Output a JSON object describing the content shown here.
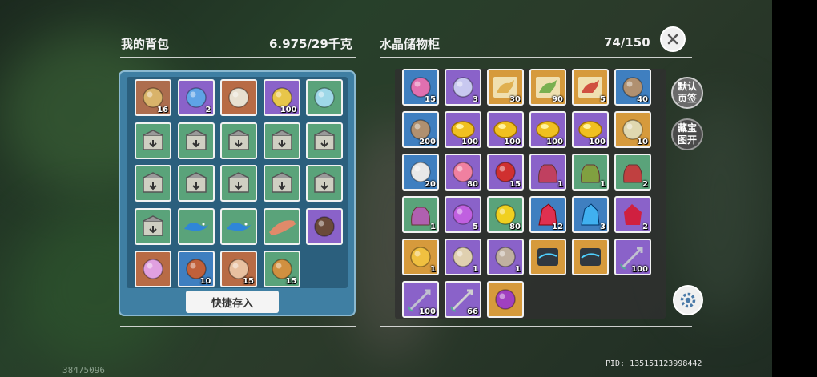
{
  "bag": {
    "title": "我的背包",
    "weight": "6.975/29千克",
    "quick_store_label": "快捷存入",
    "items": [
      {
        "count": "16",
        "bg": "#ad6d4e",
        "icon": "scroll-icon",
        "c": "#d9b36a"
      },
      {
        "count": "2",
        "bg": "#8a62c9",
        "icon": "machine-icon",
        "c": "#5fa3e6"
      },
      {
        "count": "",
        "bg": "#b86b45",
        "icon": "horn-icon",
        "c": "#e8e0d0"
      },
      {
        "count": "100",
        "bg": "#8a62c9",
        "icon": "robot-icon",
        "c": "#e8c64a"
      },
      {
        "count": "",
        "bg": "#5aa37a",
        "icon": "duck-icon",
        "c": "#9ed8e8"
      },
      {
        "count": "",
        "bg": "#5aa37a",
        "icon": "crate-icon",
        "c": "#cfcfc2"
      },
      {
        "count": "",
        "bg": "#5aa37a",
        "icon": "crate-icon",
        "c": "#cfcfc2"
      },
      {
        "count": "",
        "bg": "#5aa37a",
        "icon": "crate-icon",
        "c": "#cfcfc2"
      },
      {
        "count": "",
        "bg": "#5aa37a",
        "icon": "crate-icon",
        "c": "#cfcfc2"
      },
      {
        "count": "",
        "bg": "#5aa37a",
        "icon": "crate-icon",
        "c": "#cfcfc2"
      },
      {
        "count": "",
        "bg": "#5aa37a",
        "icon": "crate-icon",
        "c": "#cfcfc2"
      },
      {
        "count": "",
        "bg": "#5aa37a",
        "icon": "crate-icon",
        "c": "#cfcfc2"
      },
      {
        "count": "",
        "bg": "#5aa37a",
        "icon": "crate-icon",
        "c": "#cfcfc2"
      },
      {
        "count": "",
        "bg": "#5aa37a",
        "icon": "crate-icon",
        "c": "#cfcfc2"
      },
      {
        "count": "",
        "bg": "#5aa37a",
        "icon": "crate-icon",
        "c": "#cfcfc2"
      },
      {
        "count": "",
        "bg": "#5aa37a",
        "icon": "crate-icon",
        "c": "#cfcfc2"
      },
      {
        "count": "",
        "bg": "#5aa37a",
        "icon": "lizard-icon",
        "c": "#2f86d8"
      },
      {
        "count": "",
        "bg": "#5aa37a",
        "icon": "lizard-icon",
        "c": "#2f86d8"
      },
      {
        "count": "",
        "bg": "#5aa37a",
        "icon": "fish-icon",
        "c": "#e08a6a"
      },
      {
        "count": "",
        "bg": "#8a62c9",
        "icon": "bow-icon",
        "c": "#6a4a3a"
      },
      {
        "count": "",
        "bg": "#b86b45",
        "icon": "crystal-cat-icon",
        "c": "#e0a0e0"
      },
      {
        "count": "10",
        "bg": "#3f7fc0",
        "icon": "meat-icon",
        "c": "#c0603a"
      },
      {
        "count": "15",
        "bg": "#b86b45",
        "icon": "paw-bag-icon",
        "c": "#e8c0a0"
      },
      {
        "count": "15",
        "bg": "#5aa37a",
        "icon": "soup-icon",
        "c": "#d09040"
      }
    ]
  },
  "storage": {
    "title": "水晶储物柜",
    "capacity": "74/150",
    "items": [
      {
        "count": "15",
        "bg": "#3f7fc0",
        "icon": "flower-icon",
        "c": "#e070b0"
      },
      {
        "count": "3",
        "bg": "#8a62c9",
        "icon": "sparkle-icon",
        "c": "#c8c8f0"
      },
      {
        "count": "30",
        "bg": "#d69a3c",
        "icon": "dino-card-icon",
        "c": "#e0b050"
      },
      {
        "count": "90",
        "bg": "#d69a3c",
        "icon": "dino-card-icon",
        "c": "#7ab050"
      },
      {
        "count": "5",
        "bg": "#d69a3c",
        "icon": "dino-card-icon",
        "c": "#d05040"
      },
      {
        "count": "40",
        "bg": "#3f7fc0",
        "icon": "fish-plate-icon",
        "c": "#b09070"
      },
      {
        "count": "200",
        "bg": "#3f7fc0",
        "icon": "fish-plate-icon",
        "c": "#b09070"
      },
      {
        "count": "100",
        "bg": "#8a62c9",
        "icon": "gold-egg-icon",
        "c": "#f0c020"
      },
      {
        "count": "100",
        "bg": "#8a62c9",
        "icon": "gold-egg-icon",
        "c": "#f0c020"
      },
      {
        "count": "100",
        "bg": "#8a62c9",
        "icon": "gold-egg-icon",
        "c": "#f0c020"
      },
      {
        "count": "100",
        "bg": "#8a62c9",
        "icon": "gold-egg-icon",
        "c": "#f0c020"
      },
      {
        "count": "10",
        "bg": "#d69a3c",
        "icon": "feed-bag-icon",
        "c": "#e0d8b0"
      },
      {
        "count": "20",
        "bg": "#3f7fc0",
        "icon": "white-flower-icon",
        "c": "#e8e8e8"
      },
      {
        "count": "80",
        "bg": "#8a62c9",
        "icon": "lotus-icon",
        "c": "#f080a0"
      },
      {
        "count": "15",
        "bg": "#8a62c9",
        "icon": "pepper-icon",
        "c": "#d03030"
      },
      {
        "count": "1",
        "bg": "#8a62c9",
        "icon": "seed-bag-icon",
        "c": "#c04060"
      },
      {
        "count": "1",
        "bg": "#5aa37a",
        "icon": "seed-bag-icon",
        "c": "#80a040"
      },
      {
        "count": "2",
        "bg": "#5aa37a",
        "icon": "seed-bag-icon",
        "c": "#c04040"
      },
      {
        "count": "1",
        "bg": "#5aa37a",
        "icon": "seed-bag-icon",
        "c": "#b060b0"
      },
      {
        "count": "5",
        "bg": "#8a62c9",
        "icon": "potion-icon",
        "c": "#c060e0"
      },
      {
        "count": "80",
        "bg": "#5aa37a",
        "icon": "gold-gem-icon",
        "c": "#f0d020"
      },
      {
        "count": "12",
        "bg": "#3f7fc0",
        "icon": "red-crystal-icon",
        "c": "#e03050"
      },
      {
        "count": "3",
        "bg": "#3f7fc0",
        "icon": "blue-crystal-icon",
        "c": "#40b0f0"
      },
      {
        "count": "2",
        "bg": "#8a62c9",
        "icon": "ruby-icon",
        "c": "#d02040"
      },
      {
        "count": "1",
        "bg": "#d69a3c",
        "icon": "lion-badge-icon",
        "c": "#f0c040"
      },
      {
        "count": "1",
        "bg": "#8a62c9",
        "icon": "scroll-icon",
        "c": "#e0d0b0"
      },
      {
        "count": "1",
        "bg": "#8a62c9",
        "icon": "gear-bag-icon",
        "c": "#c0b0a0"
      },
      {
        "count": "",
        "bg": "#d69a3c",
        "icon": "skate-icon",
        "c": "#303840"
      },
      {
        "count": "",
        "bg": "#d69a3c",
        "icon": "skate-icon",
        "c": "#303840"
      },
      {
        "count": "100",
        "bg": "#8a62c9",
        "icon": "arrow-icon",
        "c": "#c0c0d0"
      },
      {
        "count": "100",
        "bg": "#8a62c9",
        "icon": "arrow-icon",
        "c": "#c0c0d0"
      },
      {
        "count": "66",
        "bg": "#8a62c9",
        "icon": "arrow-icon",
        "c": "#d0d0d0"
      },
      {
        "count": "",
        "bg": "#d69a3c",
        "icon": "purple-orb-icon",
        "c": "#a040c0"
      }
    ]
  },
  "tabs": {
    "default": "默认\n页签",
    "treasure": "藏宝\n图开"
  },
  "pid_label": "PID: 135151123998442",
  "corner_number": "38475096"
}
